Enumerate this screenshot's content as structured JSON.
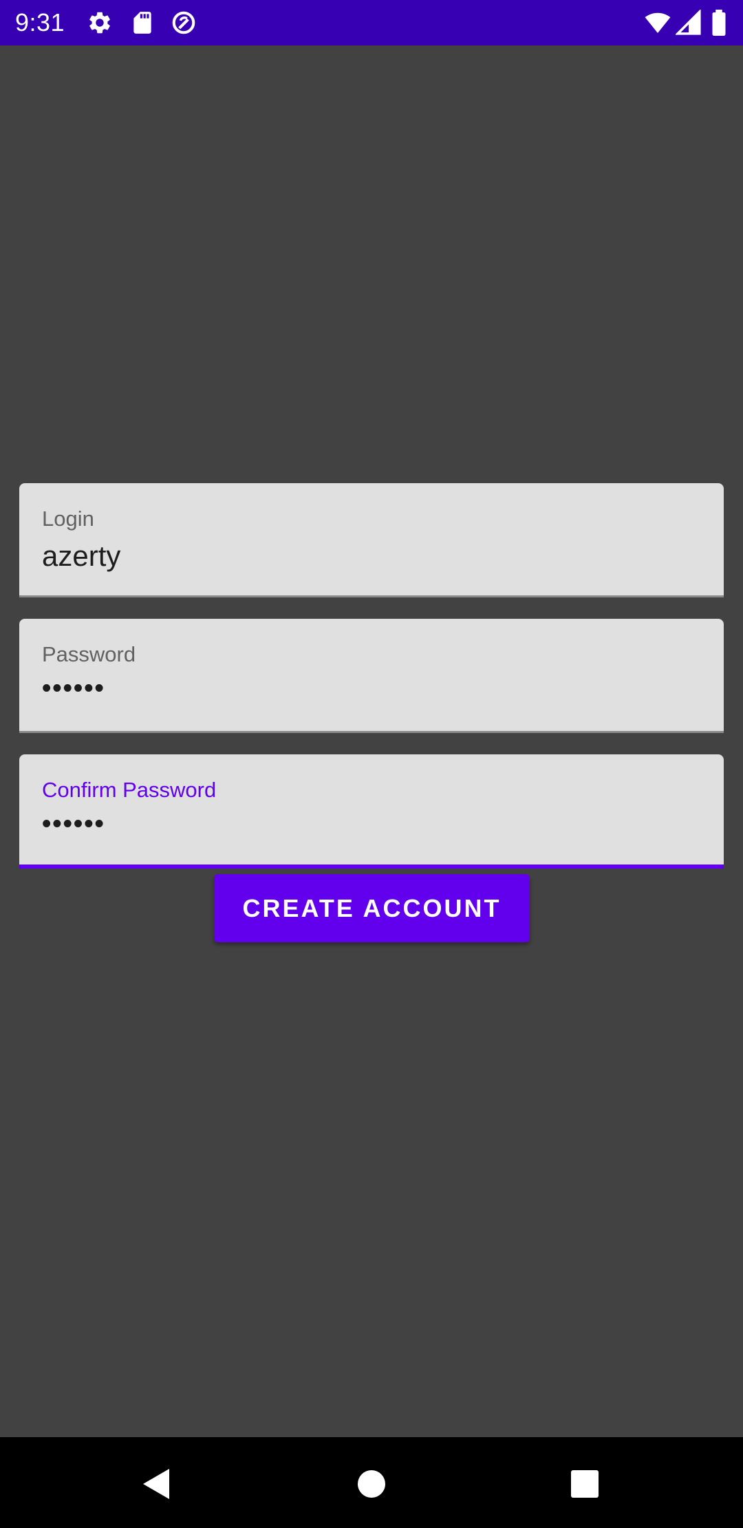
{
  "status_bar": {
    "time": "9:31",
    "background": "#3700b3",
    "left_icons": [
      "settings-gear-icon",
      "sd-card-icon",
      "data-saver-icon"
    ],
    "right_icons": [
      "wifi-icon",
      "signal-icon",
      "battery-icon"
    ]
  },
  "form": {
    "login": {
      "label": "Login",
      "value": "azerty"
    },
    "password": {
      "label": "Password",
      "value": "••••••"
    },
    "confirm_password": {
      "label": "Confirm Password",
      "value": "••••••",
      "focused": true
    },
    "create_button_label": "CREATE ACCOUNT"
  },
  "colors": {
    "accent": "#6200ee",
    "background": "#424242",
    "field_background": "#e0e0e0"
  },
  "nav_bar": {
    "buttons": [
      "back-icon",
      "home-icon",
      "recents-icon"
    ]
  }
}
